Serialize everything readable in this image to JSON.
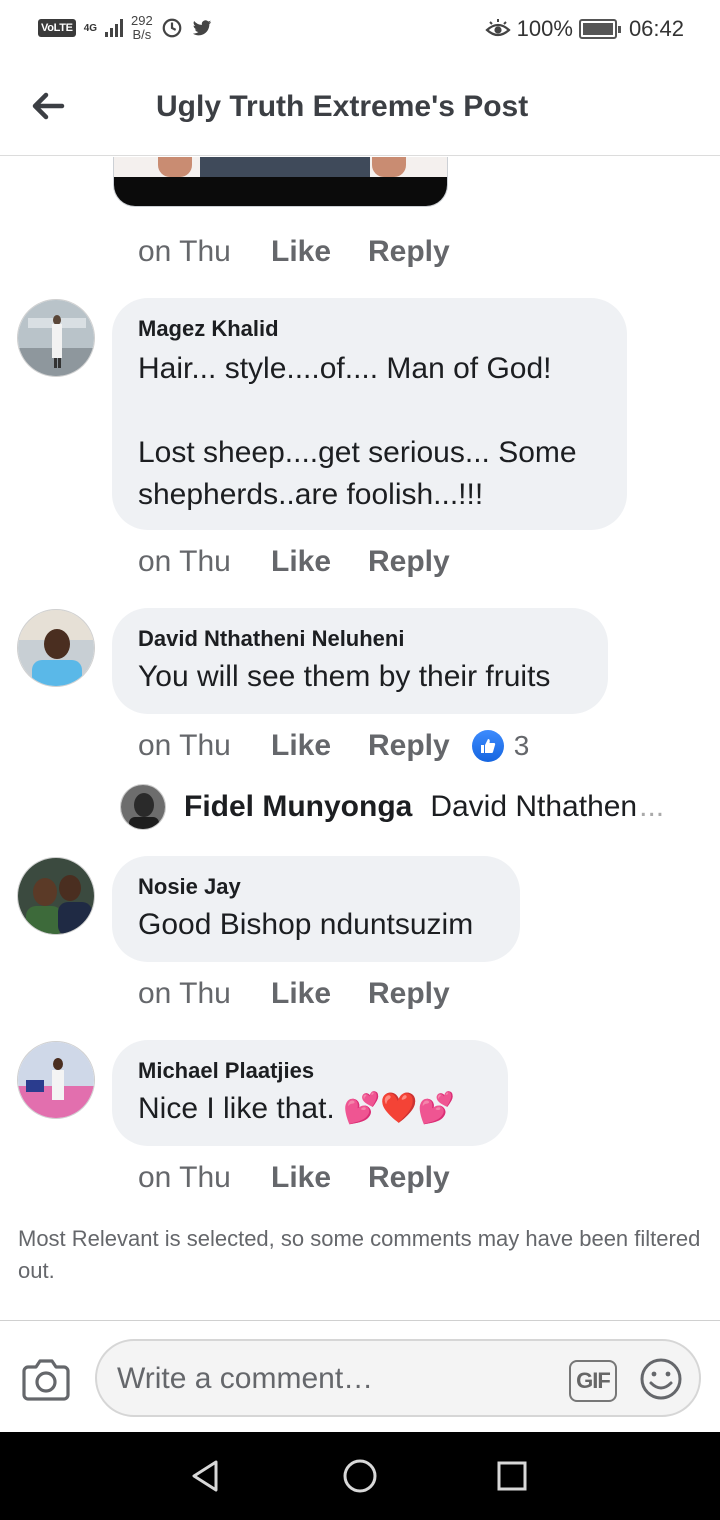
{
  "status_bar": {
    "volte": "VoLTE",
    "network": "4G",
    "speed_value": "292",
    "speed_unit": "B/s",
    "battery": "100%",
    "time": "06:42"
  },
  "header": {
    "title": "Ugly Truth Extreme's Post"
  },
  "comments": [
    {
      "author": "",
      "text": "",
      "time": "on Thu",
      "like_label": "Like",
      "reply_label": "Reply"
    },
    {
      "author": "Magez Khalid",
      "text": "Hair... style....of.... Man of God!\n\nLost sheep....get serious... Some shepherds..are foolish...!!!",
      "time": "on Thu",
      "like_label": "Like",
      "reply_label": "Reply"
    },
    {
      "author": "David Nthatheni Neluheni",
      "text": "You will see them by their fruits",
      "time": "on Thu",
      "like_label": "Like",
      "reply_label": "Reply",
      "reaction_count": "3"
    },
    {
      "author": "Nosie Jay",
      "text": "Good Bishop nduntsuzim",
      "time": "on Thu",
      "like_label": "Like",
      "reply_label": "Reply"
    },
    {
      "author": "Michael Plaatjies",
      "text": "Nice I like that. 💕❤️💕",
      "time": "on Thu",
      "like_label": "Like",
      "reply_label": "Reply"
    }
  ],
  "reply_preview": {
    "author": "Fidel Munyonga",
    "text": "David Nthathen",
    "ellipsis": "..."
  },
  "filter_note": "Most Relevant is selected, so some comments may have been filtered out.",
  "composer": {
    "placeholder": "Write a comment…",
    "gif_label": "GIF"
  },
  "colors": {
    "bubble": "#eff1f4",
    "meta_text": "#65676b",
    "like_blue": "#1877f2"
  }
}
